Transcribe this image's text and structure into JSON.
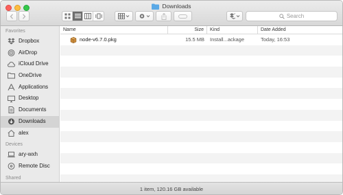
{
  "window": {
    "title": "Downloads"
  },
  "toolbar": {
    "view_modes": [
      "icon-view",
      "list-view",
      "column-view",
      "cover-flow-view"
    ],
    "active_view": "list-view",
    "search_placeholder": "Search"
  },
  "sidebar": {
    "favorites_heading": "Favorites",
    "favorites": [
      {
        "label": "Dropbox",
        "icon": "dropbox-icon"
      },
      {
        "label": "AirDrop",
        "icon": "airdrop-icon"
      },
      {
        "label": "iCloud Drive",
        "icon": "cloud-icon"
      },
      {
        "label": "OneDrive",
        "icon": "folder-icon"
      },
      {
        "label": "Applications",
        "icon": "applications-icon"
      },
      {
        "label": "Desktop",
        "icon": "desktop-icon"
      },
      {
        "label": "Documents",
        "icon": "documents-icon"
      },
      {
        "label": "Downloads",
        "icon": "downloads-icon",
        "active": true
      },
      {
        "label": "alex",
        "icon": "home-icon"
      }
    ],
    "devices_heading": "Devices",
    "devices": [
      {
        "label": "ary-wxh",
        "icon": "laptop-icon"
      },
      {
        "label": "Remote Disc",
        "icon": "disc-icon"
      }
    ],
    "shared_heading": "Shared"
  },
  "list": {
    "columns": {
      "name": "Name",
      "size": "Size",
      "kind": "Kind",
      "date": "Date Added"
    },
    "files": [
      {
        "name": "node-v6.7.0.pkg",
        "size": "15.5 MB",
        "kind": "Install...ackage",
        "date": "Today, 16:53",
        "icon": "package-icon"
      }
    ]
  },
  "status": {
    "text": "1 item, 120.16 GB available"
  },
  "colors": {
    "accent_folder": "#5aa9e6",
    "sidebar_bg": "#eaeaea",
    "selected_sidebar": "#d4d4d4"
  }
}
